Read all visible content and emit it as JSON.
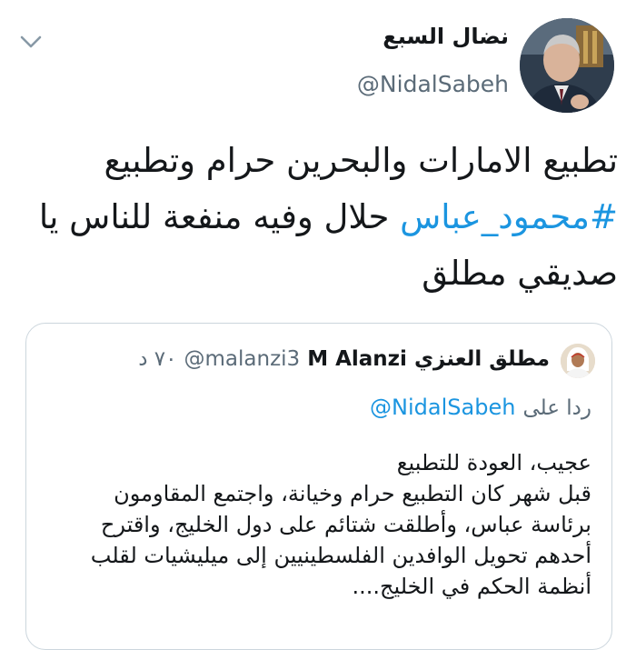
{
  "author": {
    "name": "نضال السبع",
    "handle": "@NidalSabeh"
  },
  "tweet": {
    "text_before": "تطبيع الامارات والبحرين حرام وتطبيع",
    "hashtag": "#محمود_عباس",
    "text_after": "حلال وفيه منفعة للناس يا صديقي مطلق"
  },
  "quoted": {
    "name_ar": "مطلق العنزي",
    "name_en": "M Alanzi",
    "handle": "@malanzi3",
    "time": "٧٠ د",
    "reply_prefix": "ردا على",
    "reply_to": "@NidalSabeh",
    "lines": [
      "عجيب، العودة للتطبيع",
      "قبل شهر كان التطبيع حرام وخيانة، واجتمع المقاومون",
      "برئاسة عباس، وأطلقت شتائم على دول الخليج، واقترح",
      "أحدهم تحويل الوافدين الفلسطينيين إلى ميليشيات لقلب",
      "أنظمة الحكم في الخليج...."
    ]
  },
  "colors": {
    "link": "#1b95e0",
    "secondary_text": "#5b6b78",
    "border": "#ccd6dd"
  },
  "icons": {
    "menu": "chevron-down-icon"
  }
}
